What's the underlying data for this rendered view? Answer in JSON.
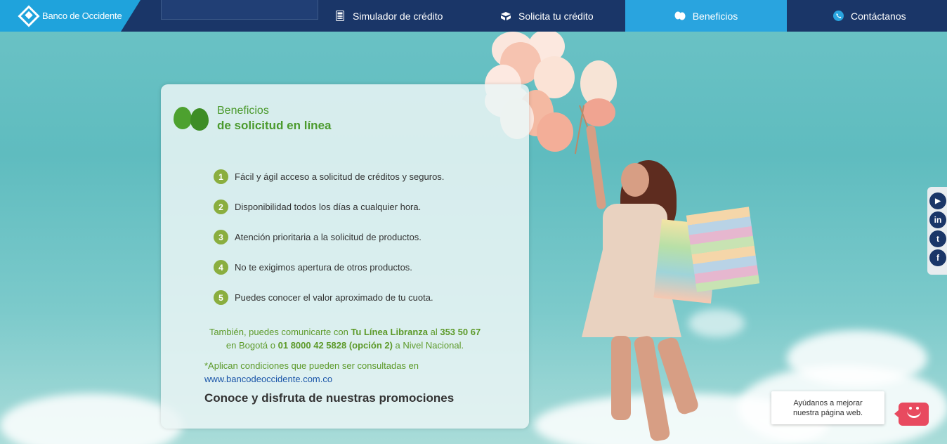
{
  "brand": {
    "name": "Banco de Occidente"
  },
  "nav": {
    "items": [
      {
        "label": "Simulador de crédito",
        "icon": "calculator-icon"
      },
      {
        "label": "Solicita tu crédito",
        "icon": "boxes-icon"
      },
      {
        "label": "Beneficios",
        "icon": "balloons-icon",
        "active": true
      },
      {
        "label": "Contáctanos",
        "icon": "phone-icon"
      }
    ]
  },
  "card": {
    "title_line1": "Beneficios",
    "title_line2": "de solicitud en línea",
    "benefits": [
      {
        "num": "1",
        "text": "Fácil y ágil acceso a solicitud de créditos y seguros."
      },
      {
        "num": "2",
        "text": "Disponibilidad todos los días a cualquier hora."
      },
      {
        "num": "3",
        "text": "Atención prioritaria a la solicitud de productos."
      },
      {
        "num": "4",
        "text": "No te exigimos apertura de otros productos."
      },
      {
        "num": "5",
        "text": "Puedes conocer el valor aproximado de tu cuota."
      }
    ],
    "contact": {
      "p1": "También, puedes comunicarte con ",
      "line_name": "Tu Línea Libranza",
      "p2": " al ",
      "phone_bogota": "353 50 67",
      "p3": "en Bogotá o ",
      "phone_national": "01 8000 42 5828 (opción 2)",
      "p4": " a Nivel Nacional."
    },
    "conditions_text": "*Aplican condiciones que pueden ser consultadas en",
    "conditions_link": "www.bancodeoccidente.com.co",
    "promo": "Conoce y disfruta de nuestras promociones"
  },
  "social": [
    {
      "icon": "youtube-icon",
      "glyph": "▶"
    },
    {
      "icon": "linkedin-icon",
      "glyph": "in"
    },
    {
      "icon": "twitter-icon",
      "glyph": "t"
    },
    {
      "icon": "facebook-icon",
      "glyph": "f"
    }
  ],
  "feedback": {
    "line1": "Ayúdanos a mejorar",
    "line2": "nuestra página web."
  },
  "colors": {
    "nav_bg": "#1a3668",
    "nav_active": "#29a4df",
    "brand_blue": "#1fa3dc",
    "green": "#4b9a2d",
    "feedback_red": "#e84a5f"
  }
}
